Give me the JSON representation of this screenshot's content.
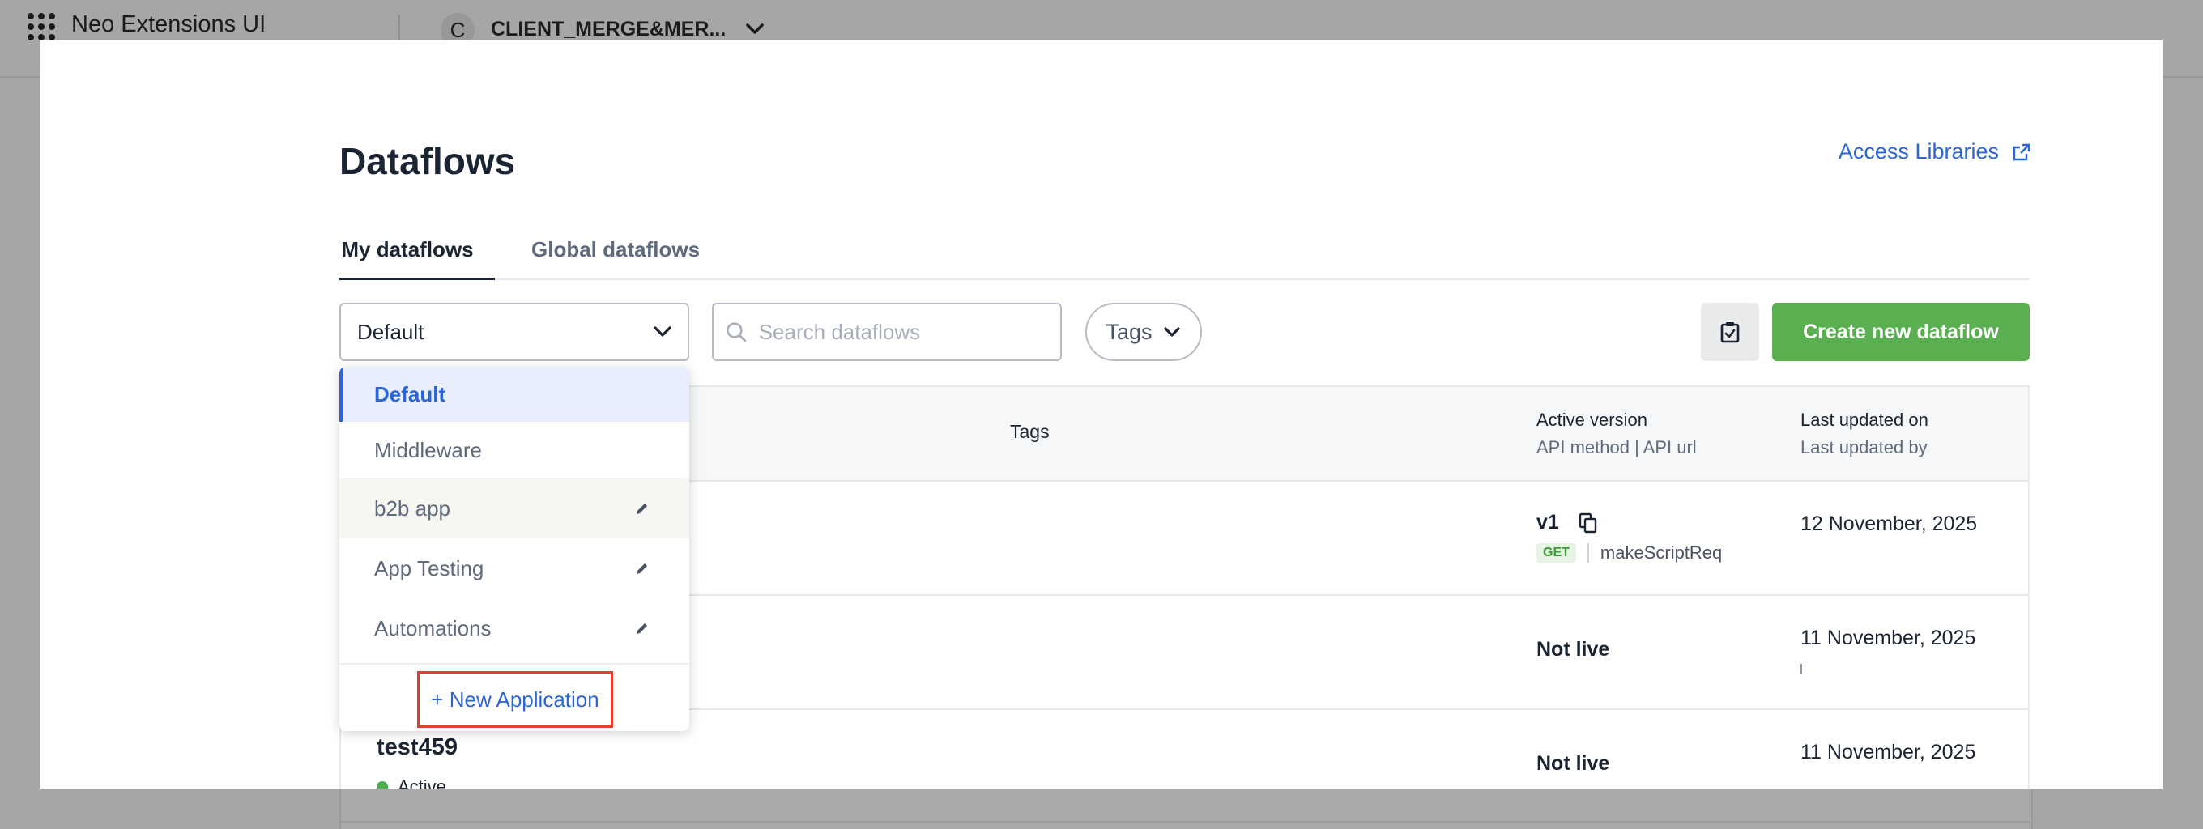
{
  "header": {
    "app_title": "Neo Extensions UI",
    "client_initial": "C",
    "client_name": "CLIENT_MERGE&MER..."
  },
  "page": {
    "title": "Dataflows",
    "access_libraries": "Access Libraries"
  },
  "tabs": [
    {
      "label": "My dataflows",
      "active": true
    },
    {
      "label": "Global dataflows",
      "active": false
    }
  ],
  "filters": {
    "application_selected": "Default",
    "search_placeholder": "Search dataflows",
    "tags_label": "Tags",
    "create_label": "Create new dataflow"
  },
  "dropdown": {
    "items": [
      {
        "label": "Default",
        "selected": true
      },
      {
        "label": "Middleware"
      },
      {
        "label": "b2b app",
        "editable": true
      },
      {
        "label": "App Testing",
        "editable": true
      },
      {
        "label": "Automations",
        "editable": true
      }
    ],
    "new_application": "+ New Application"
  },
  "table": {
    "headers": {
      "tags": "Tags",
      "active_version": "Active version",
      "api_method_url": "API method | API url",
      "last_updated_on": "Last updated on",
      "last_updated_by": "Last updated by"
    },
    "rows": [
      {
        "version": "v1",
        "method": "GET",
        "api_url": "makeScriptReq",
        "updated": "12 November, 2025"
      },
      {
        "version_status": "Not live",
        "updated": "11 November, 2025"
      },
      {
        "name": "test459",
        "status": "Active",
        "version_status": "Not live",
        "updated": "11 November, 2025"
      }
    ]
  },
  "colors": {
    "accent_blue": "#2c66d4",
    "create_green": "#5aaf50",
    "active_dot": "#4caf50",
    "highlight_red": "#e0412e"
  }
}
